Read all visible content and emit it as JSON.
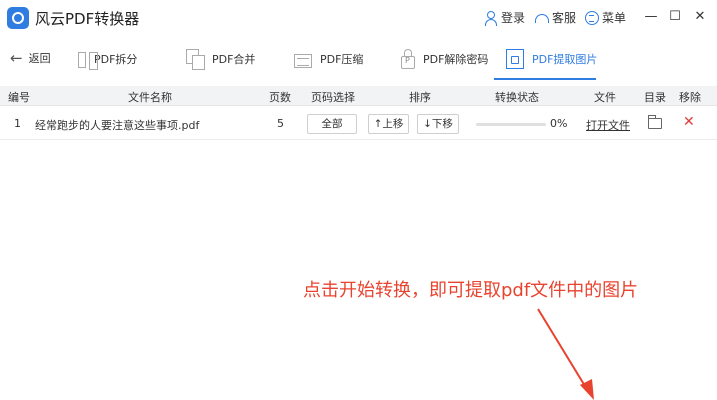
{
  "titlebar": {
    "title": "风云PDF转换器",
    "login": "登录",
    "service": "客服",
    "menu": "菜单",
    "minimize": "—",
    "maximize": "☐",
    "close": "✕"
  },
  "toolbar": {
    "back": "返回",
    "tools": [
      {
        "label": "PDF拆分",
        "icon": "split-icon"
      },
      {
        "label": "PDF合并",
        "icon": "merge-icon"
      },
      {
        "label": "PDF压缩",
        "icon": "compress-icon"
      },
      {
        "label": "PDF解除密码",
        "icon": "unlock-icon"
      },
      {
        "label": "PDF提取图片",
        "icon": "image-icon",
        "active": true
      }
    ]
  },
  "table": {
    "headers": [
      "编号",
      "文件名称",
      "页数",
      "页码选择",
      "排序",
      "转换状态",
      "文件",
      "目录",
      "移除"
    ],
    "rows": [
      {
        "index": "1",
        "filename": "经常跑步的人要注意这些事项.pdf",
        "pages": "5",
        "page_select": "全部",
        "move_up": "↑上移",
        "move_down": "↓下移",
        "progress": 0,
        "status": "0%",
        "open_file": "打开文件",
        "remove": "✕"
      }
    ]
  },
  "annotation": {
    "text": "点击开始转换，即可提取pdf文件中的图片",
    "color": "#e8432f"
  },
  "colors": {
    "accent": "#2f7de1"
  }
}
